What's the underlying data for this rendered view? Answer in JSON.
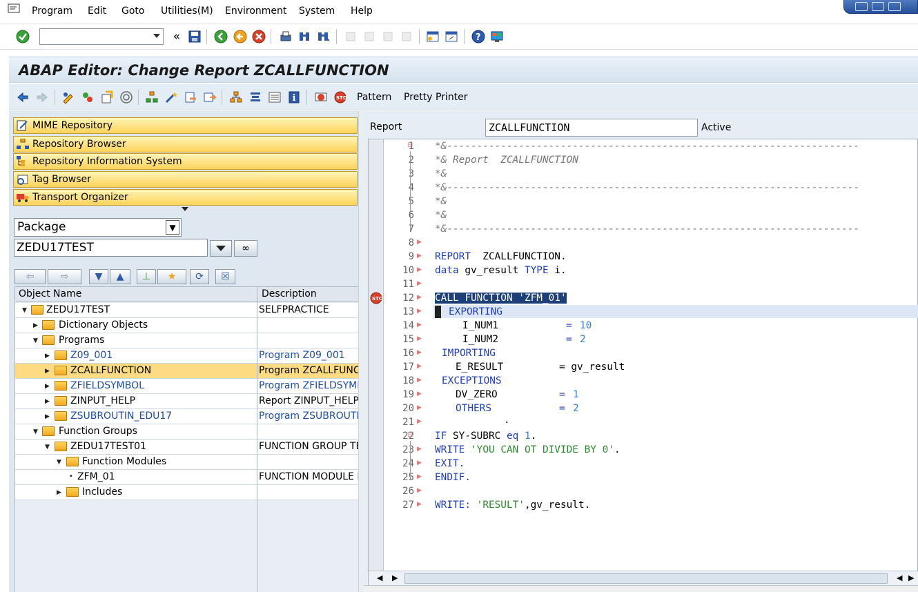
{
  "menubar": {
    "items": [
      "Program",
      "Edit",
      "Goto",
      "Utilities(M)",
      "Environment",
      "System",
      "Help"
    ]
  },
  "system_toolbar": {
    "command_field_value": "",
    "icons": [
      "enter-icon",
      "save-icon",
      "back-icon",
      "exit-icon",
      "cancel-icon",
      "print-icon",
      "find-icon",
      "find-next-icon",
      "first-page-icon",
      "previous-page-icon",
      "next-page-icon",
      "last-page-icon",
      "new-session-icon",
      "create-shortcut-icon",
      "help-icon",
      "customize-layout-icon"
    ]
  },
  "title": "ABAP Editor: Change Report ZCALLFUNCTION",
  "app_toolbar": {
    "pattern_label": "Pattern",
    "pretty_printer_label": "Pretty Printer"
  },
  "navigation": {
    "buttons": [
      "MIME Repository",
      "Repository Browser",
      "Repository Information System",
      "Tag Browser",
      "Transport Organizer"
    ],
    "object_type": "Package",
    "object_name": "ZEDU17TEST"
  },
  "tree": {
    "columns": [
      "Object Name",
      "Description"
    ],
    "rows": [
      {
        "name": "ZEDU17TEST",
        "desc": "SELFPRACTICE"
      },
      {
        "name": "Dictionary Objects",
        "desc": ""
      },
      {
        "name": "Programs",
        "desc": ""
      },
      {
        "name": "Z09_001",
        "desc": "Program Z09_001"
      },
      {
        "name": "ZCALLFUNCTION",
        "desc": "Program ZCALLFUNCT"
      },
      {
        "name": "ZFIELDSYMBOL",
        "desc": "Program ZFIELDSYMB"
      },
      {
        "name": "ZINPUT_HELP",
        "desc": "Report ZINPUT_HELP"
      },
      {
        "name": "ZSUBROUTIN_EDU17",
        "desc": "Program ZSUBROUTIN"
      },
      {
        "name": "Function Groups",
        "desc": ""
      },
      {
        "name": "ZEDU17TEST01",
        "desc": "FUNCTION GROUP TE"
      },
      {
        "name": "Function Modules",
        "desc": ""
      },
      {
        "name": "ZFM_01",
        "desc": "FUNCTION MODULE F"
      },
      {
        "name": "Includes",
        "desc": ""
      }
    ]
  },
  "editor": {
    "report_label": "Report",
    "report_name": "ZCALLFUNCTION",
    "status": "Active",
    "line_numbers": [
      "1",
      "2",
      "3",
      "4",
      "5",
      "6",
      "7",
      "8",
      "9",
      "10",
      "11",
      "12",
      "13",
      "14",
      "15",
      "16",
      "17",
      "18",
      "19",
      "20",
      "21",
      "22",
      "23",
      "24",
      "25",
      "26",
      "27"
    ],
    "code": {
      "l1": "*&---------------------------------------------------------------------",
      "l2": "*& Report  ZCALLFUNCTION",
      "l3": "*&",
      "l4": "*&---------------------------------------------------------------------",
      "l5": "*&",
      "l6": "*&",
      "l7": "*&---------------------------------------------------------------------",
      "l9a": "REPORT",
      "l9b": "  ZCALLFUNCTION.",
      "l10a": "data",
      "l10b": " gv_result ",
      "l10c": "TYPE",
      "l10d": " i.",
      "l12": "CALL FUNCTION 'ZFM_01'",
      "l13": "EXPORTING",
      "l14a": "I_NUM1",
      "l14b": "=",
      "l14c": "10",
      "l15a": "I_NUM2",
      "l15b": "=",
      "l15c": "2",
      "l16": "IMPORTING",
      "l17a": "E_RESULT",
      "l17b": "= gv_result",
      "l18": "EXCEPTIONS",
      "l19a": "DV_ZERO",
      "l19b": "=",
      "l19c": "1",
      "l20a": "OTHERS",
      "l20b": "=",
      "l20c": "2",
      "l21": ".",
      "l22a": "IF",
      "l22b": " SY-SUBRC ",
      "l22c": "eq",
      "l22d": "1",
      "l22e": ".",
      "l23a": "WRITE",
      "l23b": "'YOU CAN OT DIVIDE BY 0'",
      "l23c": ".",
      "l24": "EXIT.",
      "l25": "ENDIF.",
      "l27a": "WRITE:",
      "l27b": "'RESULT'",
      "l27c": ",gv_result."
    }
  },
  "colors": {
    "title_bg": "#d6e3ef",
    "nav_button": "#ffd35a",
    "selected_row": "#fcdb82",
    "keyword": "#1f3fb8",
    "string": "#2d8a2e",
    "number": "#3a7fd0",
    "comment": "#777777"
  }
}
